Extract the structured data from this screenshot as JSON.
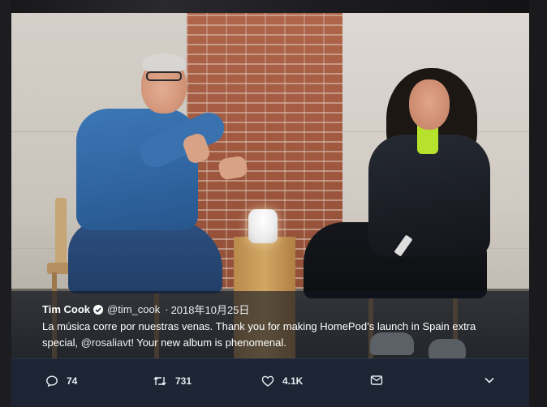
{
  "tweet": {
    "display_name": "Tim Cook",
    "handle": "@tim_cook",
    "separator": "·",
    "date": "2018年10月25日",
    "text_part1": "La música corre por nuestras venas. Thank you for making HomePod’s launch in Spain extra special, ",
    "mention": "@rosaliavt",
    "text_part2": "!  Your new album is phenomenal."
  },
  "actions": {
    "reply_count": "74",
    "retweet_count": "731",
    "like_count": "4.1K"
  },
  "icons": [
    "reply-icon",
    "retweet-icon",
    "like-icon",
    "message-icon",
    "chevron-down-icon",
    "verified-icon"
  ],
  "colors": {
    "overlay_bg": "#101622",
    "action_bar_bg": "#1d2535",
    "text": "#ffffff"
  }
}
